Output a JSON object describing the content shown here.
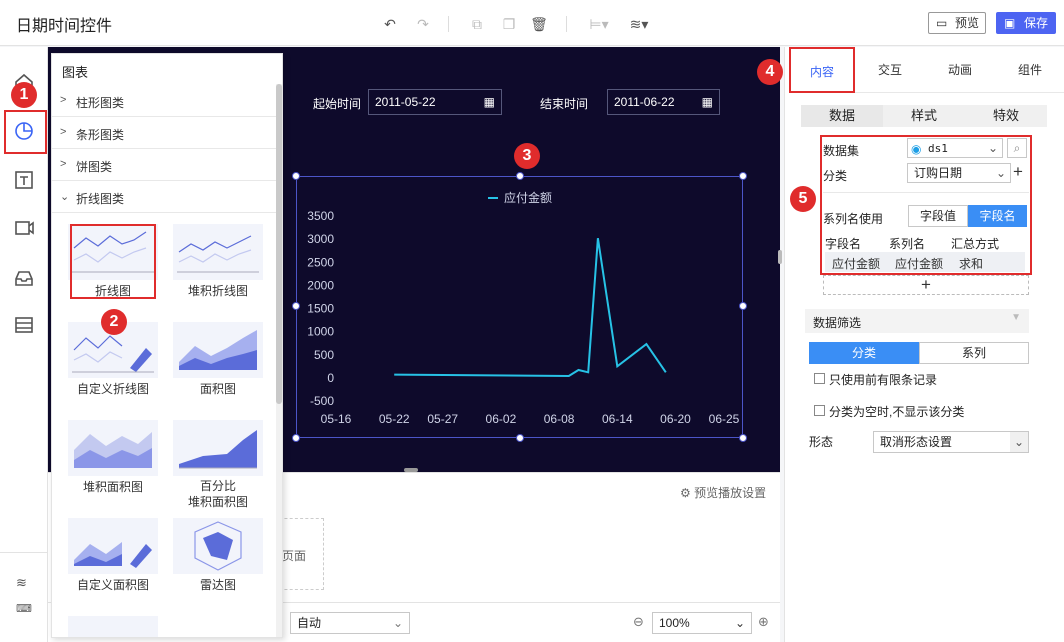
{
  "app": {
    "title": "日期时间控件"
  },
  "toolbar": {
    "preview_label": "预览",
    "save_label": "保存"
  },
  "chart_panel": {
    "title": "图表",
    "categories": [
      {
        "label": "柱形图类",
        "expanded": false
      },
      {
        "label": "条形图类",
        "expanded": false
      },
      {
        "label": "饼图类",
        "expanded": false
      },
      {
        "label": "折线图类",
        "expanded": true
      }
    ],
    "thumbs": [
      {
        "label": "折线图"
      },
      {
        "label": "堆积折线图"
      },
      {
        "label": "自定义折线图"
      },
      {
        "label": "面积图"
      },
      {
        "label": "堆积面积图"
      },
      {
        "label": "百分比\n堆积面积图"
      },
      {
        "label": "自定义面积图"
      },
      {
        "label": "雷达图"
      }
    ]
  },
  "dates": {
    "start_label": "起始时间",
    "start_value": "2011-05-22",
    "end_label": "结束时间",
    "end_value": "2011-06-22"
  },
  "lower": {
    "preview_settings": "预览播放设置",
    "page_label": "页面",
    "auto_label": "自动",
    "zoom": "100%"
  },
  "markers": [
    "1",
    "2",
    "3",
    "4",
    "5"
  ],
  "right_panel": {
    "tabs": [
      "内容",
      "交互",
      "动画",
      "组件"
    ],
    "active_tab": "内容",
    "sub_tabs": [
      "数据",
      "样式",
      "特效"
    ],
    "dataset_label": "数据集",
    "dataset_value": "ds1",
    "category_label": "分类",
    "category_value": "订购日期",
    "series_use_label": "系列名使用",
    "series_use_options": [
      "字段值",
      "字段名"
    ],
    "series_use_active": "字段名",
    "table_headers": [
      "字段名",
      "系列名",
      "汇总方式"
    ],
    "table_row": [
      "应付金额",
      "应付金额",
      "求和"
    ],
    "filter_label": "数据筛选",
    "filter_tabs": [
      "分类",
      "系列"
    ],
    "filter_active": "分类",
    "check_limit": "只使用前有限条记录",
    "check_empty": "分类为空时,不显示该分类",
    "form_label": "形态",
    "form_value": "取消形态设置"
  },
  "chart_data": {
    "type": "line",
    "legend": [
      "应付金额"
    ],
    "x_ticks": [
      "05-16",
      "05-22",
      "05-27",
      "06-02",
      "06-08",
      "06-14",
      "06-20",
      "06-25"
    ],
    "y_ticks": [
      "3500",
      "3000",
      "2500",
      "2000",
      "1500",
      "1000",
      "500",
      "0",
      "-500"
    ],
    "ylim": [
      -500,
      3500
    ],
    "series": [
      {
        "name": "应付金额",
        "color": "#27c2e6",
        "points": [
          [
            "05-22",
            70
          ],
          [
            "06-09",
            40
          ],
          [
            "06-10",
            170
          ],
          [
            "06-11",
            120
          ],
          [
            "06-12",
            3020
          ],
          [
            "06-14",
            250
          ],
          [
            "06-17",
            730
          ],
          [
            "06-19",
            120
          ]
        ]
      }
    ]
  }
}
